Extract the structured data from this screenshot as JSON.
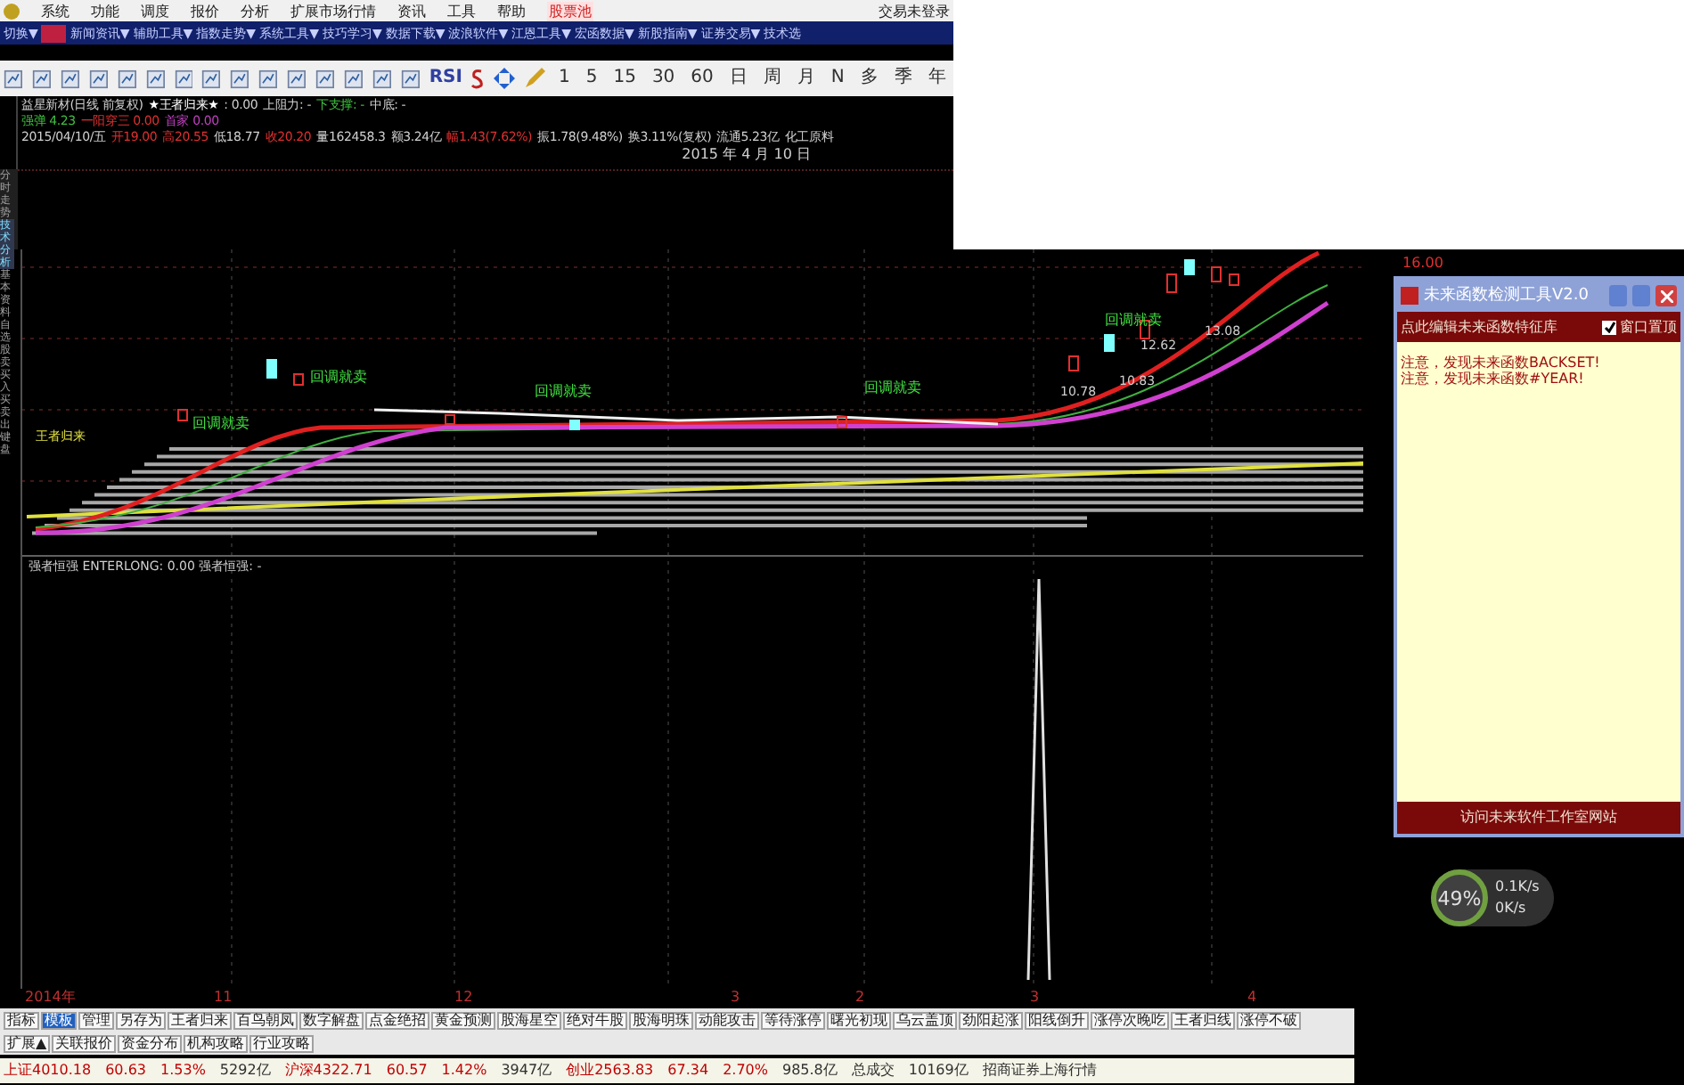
{
  "menu": {
    "items": [
      {
        "label": "系统",
        "highlighted": false
      },
      {
        "label": "功能",
        "highlighted": false
      },
      {
        "label": "调度",
        "highlighted": false
      },
      {
        "label": "报价",
        "highlighted": false
      },
      {
        "label": "分析",
        "highlighted": false
      },
      {
        "label": "扩展市场行情",
        "highlighted": false
      },
      {
        "label": "资讯",
        "highlighted": false
      },
      {
        "label": "工具",
        "highlighted": false
      },
      {
        "label": "帮助",
        "highlighted": false
      },
      {
        "label": "股票池",
        "highlighted": true
      }
    ],
    "login_status": "交易未登录"
  },
  "nav_toolbar": [
    {
      "label": "切换▼",
      "selected": false
    },
    {
      "label": "新闻资讯▼",
      "selected": false
    },
    {
      "label": "辅助工具▼",
      "selected": false
    },
    {
      "label": "指数走势▼",
      "selected": false
    },
    {
      "label": "系统工具▼",
      "selected": false
    },
    {
      "label": "技巧学习▼",
      "selected": false
    },
    {
      "label": "数据下载▼",
      "selected": false
    },
    {
      "label": "波浪软件▼",
      "selected": false
    },
    {
      "label": "江恩工具▼",
      "selected": false
    },
    {
      "label": "宏函数据▼",
      "selected": false
    },
    {
      "label": "新股指南▼",
      "selected": false
    },
    {
      "label": "证券交易▼",
      "selected": false
    },
    {
      "label": "技术选",
      "selected": false
    }
  ],
  "tool_toolbar": {
    "indicator_button": "RSI",
    "periods": [
      "1",
      "5",
      "15",
      "30",
      "60",
      "日",
      "周",
      "月",
      "N",
      "多",
      "季",
      "年"
    ]
  },
  "vertical_tabs": [
    {
      "label": "分时走势",
      "selected": false
    },
    {
      "label": "技术分析",
      "selected": true
    },
    {
      "label": "基本资料",
      "selected": false
    },
    {
      "label": "自选股",
      "selected": false
    },
    {
      "label": "卖买入",
      "selected": false
    },
    {
      "label": "买卖出",
      "selected": false
    },
    {
      "label": "键盘",
      "selected": false
    }
  ],
  "stock_info": {
    "lines": [
      [
        {
          "text": "益星新材(日线 前复权)",
          "color": "#d0d0d0"
        },
        {
          "text": "★王者归来★",
          "color": "#ffffff"
        },
        {
          "text": ": 0.00",
          "color": "#d0d0d0"
        },
        {
          "text": "上阻力: -",
          "color": "#d0d0d0"
        },
        {
          "text": "下支撑: -",
          "color": "#40c040"
        },
        {
          "text": "中底: -",
          "color": "#d0d0d0"
        }
      ],
      [
        {
          "text": "强弹 4.23",
          "color": "#40c040"
        },
        {
          "text": "一阳穿三 0.00",
          "color": "#e03030"
        },
        {
          "text": "首家 0.00",
          "color": "#c040c0"
        }
      ],
      [
        {
          "text": "2015/04/10/五",
          "color": "#d0d0d0"
        },
        {
          "text": "开19.00",
          "color": "#e03030"
        },
        {
          "text": "高20.55",
          "color": "#e03030"
        },
        {
          "text": "低18.77",
          "color": "#d0d0d0"
        },
        {
          "text": "收20.20",
          "color": "#e03030"
        },
        {
          "text": "量162458.3",
          "color": "#d0d0d0"
        },
        {
          "text": "额3.24亿",
          "color": "#d0d0d0"
        },
        {
          "text": "幅1.43(7.62%)",
          "color": "#e03030"
        },
        {
          "text": "振1.78(9.48%)",
          "color": "#d0d0d0"
        },
        {
          "text": "换3.11%(复权)",
          "color": "#d0d0d0"
        },
        {
          "text": "流通5.23亿",
          "color": "#d0d0d0"
        },
        {
          "text": "化工原料",
          "color": "#d0d0d0"
        }
      ]
    ],
    "date": "2015 年 4 月 10 日"
  },
  "chart": {
    "signals": [
      "回调就卖",
      "回调就卖",
      "回调就卖",
      "回调就卖",
      "回调就卖"
    ],
    "price_labels": [
      "10.78",
      "10.83",
      "12.62",
      "13.08"
    ],
    "pattern_label": "王者归来",
    "axis_price": "16.00",
    "indicator_label": "强者恒强 ENTERLONG: 0.00 强者恒强: -",
    "date_axis": [
      "2014年",
      "11",
      "12",
      "3",
      "2",
      "3",
      "4"
    ]
  },
  "dialog": {
    "title": "未来函数检测工具V2.0",
    "edit_link": "点此编辑未来函数特征库",
    "pin_checkbox": {
      "label": "窗口置顶",
      "checked": true
    },
    "messages": [
      "注意，发现未来函数BACKSET!",
      "注意，发现未来函数#YEAR!"
    ],
    "footer_button": "访问未来软件工作室网站"
  },
  "network_widget": {
    "percent": "49%",
    "upload": "0.1K/s",
    "download": "0K/s"
  },
  "bottom_tabs": [
    {
      "label": "指标",
      "selected": false
    },
    {
      "label": "模板",
      "selected": true
    },
    {
      "label": "管理",
      "selected": false
    },
    {
      "label": "另存为",
      "selected": false
    },
    {
      "label": "王者归来",
      "selected": false
    },
    {
      "label": "百鸟朝凤",
      "selected": false
    },
    {
      "label": "数字解盘",
      "selected": false
    },
    {
      "label": "点金绝招",
      "selected": false
    },
    {
      "label": "黄金预测",
      "selected": false
    },
    {
      "label": "股海星空",
      "selected": false
    },
    {
      "label": "绝对牛股",
      "selected": false
    },
    {
      "label": "股海明珠",
      "selected": false
    },
    {
      "label": "动能攻击",
      "selected": false
    },
    {
      "label": "等待涨停",
      "selected": false
    },
    {
      "label": "曙光初现",
      "selected": false
    },
    {
      "label": "乌云盖顶",
      "selected": false
    },
    {
      "label": "劲阳起涨",
      "selected": false
    },
    {
      "label": "阳线倒升",
      "selected": false
    },
    {
      "label": "涨停次晚吃",
      "selected": false
    },
    {
      "label": "王者归线",
      "selected": false
    },
    {
      "label": "涨停不破",
      "selected": false
    }
  ],
  "extra_tabs": [
    "扩展▲",
    "关联报价",
    "资金分布",
    "机构攻略",
    "行业攻略"
  ],
  "status_bar": [
    {
      "text": "上证4010.18",
      "color": "#c00000"
    },
    {
      "text": "60.63",
      "color": "#c00000"
    },
    {
      "text": "1.53%",
      "color": "#c00000"
    },
    {
      "text": "5292亿",
      "color": "#303030"
    },
    {
      "text": "沪深4322.71",
      "color": "#c00000"
    },
    {
      "text": "60.57",
      "color": "#c00000"
    },
    {
      "text": "1.42%",
      "color": "#c00000"
    },
    {
      "text": "3947亿",
      "color": "#303030"
    },
    {
      "text": "创业2563.83",
      "color": "#c00000"
    },
    {
      "text": "67.34",
      "color": "#c00000"
    },
    {
      "text": "2.70%",
      "color": "#c00000"
    },
    {
      "text": "985.8亿",
      "color": "#303030"
    },
    {
      "text": "总成交",
      "color": "#303030"
    },
    {
      "text": "10169亿",
      "color": "#303030"
    },
    {
      "text": "招商证券上海行情",
      "color": "#303030"
    }
  ]
}
